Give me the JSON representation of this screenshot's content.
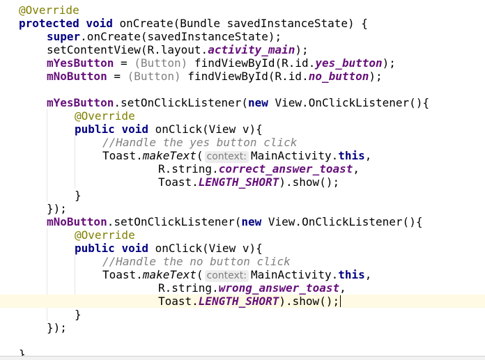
{
  "editor": {
    "lines": [
      [
        {
          "t": "@Override",
          "c": "ann"
        }
      ],
      [
        {
          "t": "protected",
          "c": "kw"
        },
        {
          "t": " "
        },
        {
          "t": "void",
          "c": "kw"
        },
        {
          "t": " onCreate(Bundle savedInstanceState) {"
        }
      ],
      [
        {
          "t": "super",
          "c": "kw"
        },
        {
          "t": ".onCreate(savedInstanceState);"
        }
      ],
      [
        {
          "t": "setContentView(R.layout."
        },
        {
          "t": "activity_main",
          "c": "static"
        },
        {
          "t": ");"
        }
      ],
      [
        {
          "t": "mYesButton",
          "c": "field"
        },
        {
          "t": " = "
        },
        {
          "t": "(Button)",
          "c": "cast"
        },
        {
          "t": " findViewById(R.id."
        },
        {
          "t": "yes_button",
          "c": "static"
        },
        {
          "t": ");"
        }
      ],
      [
        {
          "t": "mNoButton",
          "c": "field"
        },
        {
          "t": " = "
        },
        {
          "t": "(Button)",
          "c": "cast"
        },
        {
          "t": " findViewById(R.id."
        },
        {
          "t": "no_button",
          "c": "static"
        },
        {
          "t": ");"
        }
      ],
      [],
      [
        {
          "t": "mYesButton",
          "c": "field"
        },
        {
          "t": ".setOnClickListener("
        },
        {
          "t": "new",
          "c": "kw"
        },
        {
          "t": " View.OnClickListener(){"
        }
      ],
      [
        {
          "t": "@Override",
          "c": "ann"
        }
      ],
      [
        {
          "t": "public",
          "c": "kw"
        },
        {
          "t": " "
        },
        {
          "t": "void",
          "c": "kw"
        },
        {
          "t": " onClick(View v){"
        }
      ],
      [
        {
          "t": "//Handle the yes button click",
          "c": "comment"
        }
      ],
      [
        {
          "t": "Toast."
        },
        {
          "t": "makeText",
          "c": "mstatic"
        },
        {
          "t": "("
        },
        {
          "t": "context:",
          "c": "hint"
        },
        {
          "t": "MainActivity."
        },
        {
          "t": "this",
          "c": "kw"
        },
        {
          "t": ","
        }
      ],
      [
        {
          "t": "R.string."
        },
        {
          "t": "correct_answer_toast",
          "c": "static"
        },
        {
          "t": ","
        }
      ],
      [
        {
          "t": "Toast."
        },
        {
          "t": "LENGTH_SHORT",
          "c": "static"
        },
        {
          "t": ").show();"
        }
      ],
      [
        {
          "t": "}"
        }
      ],
      [
        {
          "t": "});"
        }
      ],
      [
        {
          "t": "mNoButton",
          "c": "field"
        },
        {
          "t": ".setOnClickListener("
        },
        {
          "t": "new",
          "c": "kw"
        },
        {
          "t": " View.OnClickListener(){"
        }
      ],
      [
        {
          "t": "@Override",
          "c": "ann"
        }
      ],
      [
        {
          "t": "public",
          "c": "kw"
        },
        {
          "t": " "
        },
        {
          "t": "void",
          "c": "kw"
        },
        {
          "t": " onClick(View v){"
        }
      ],
      [
        {
          "t": "//Handle the no button click",
          "c": "comment"
        }
      ],
      [
        {
          "t": "Toast."
        },
        {
          "t": "makeText",
          "c": "mstatic"
        },
        {
          "t": "("
        },
        {
          "t": "context:",
          "c": "hint"
        },
        {
          "t": "MainActivity."
        },
        {
          "t": "this",
          "c": "kw"
        },
        {
          "t": ","
        }
      ],
      [
        {
          "t": "R.string."
        },
        {
          "t": "wrong_answer_toast",
          "c": "static"
        },
        {
          "t": ","
        }
      ],
      [
        {
          "t": "Toast."
        },
        {
          "t": "LENGTH_SHORT",
          "c": "static"
        },
        {
          "t": ").show();"
        }
      ],
      [
        {
          "t": "}"
        }
      ],
      [
        {
          "t": "});"
        }
      ],
      [],
      [
        {
          "t": "}"
        }
      ]
    ],
    "current_line": 22,
    "colors": {
      "keyword": "#000080",
      "annotation": "#808000",
      "field": "#660e7a",
      "comment": "#808080",
      "current_line_bg": "#fffae3"
    }
  }
}
